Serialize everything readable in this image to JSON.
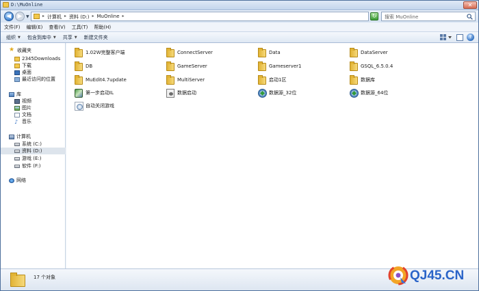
{
  "window": {
    "title": "D:\\MuOnline"
  },
  "address": {
    "crumbs": [
      "计算机",
      "资料 (D:)",
      "MuOnline"
    ],
    "search_placeholder": "搜索 MuOnline"
  },
  "menu": [
    "文件(F)",
    "编辑(E)",
    "查看(V)",
    "工具(T)",
    "帮助(H)"
  ],
  "toolbar": {
    "organize": "组织",
    "include_in_library": "包含到库中",
    "share": "共享",
    "new_folder": "新建文件夹"
  },
  "nav": {
    "favorites": {
      "label": "收藏夹",
      "items": [
        "2345Downloads",
        "下载",
        "桌面",
        "最近访问的位置"
      ]
    },
    "libraries": {
      "label": "库",
      "items": [
        "视频",
        "图片",
        "文档",
        "音乐"
      ]
    },
    "computer": {
      "label": "计算机",
      "items": [
        "系统 (C:)",
        "资料 (D:)",
        "游戏 (E:)",
        "软件 (F:)"
      ],
      "selected": "资料 (D:)"
    },
    "network": {
      "label": "网络"
    }
  },
  "files": [
    {
      "name": "1.02W完整客户端",
      "icon": "folder-icon"
    },
    {
      "name": "ConnectServer",
      "icon": "folder-icon"
    },
    {
      "name": "Data",
      "icon": "folder-icon"
    },
    {
      "name": "DataServer",
      "icon": "folder-icon"
    },
    {
      "name": "DB",
      "icon": "folder-icon"
    },
    {
      "name": "GameServer",
      "icon": "folder-icon"
    },
    {
      "name": "Gameserver1",
      "icon": "folder-icon"
    },
    {
      "name": "GSQL_6.5.0.4",
      "icon": "folder-icon"
    },
    {
      "name": "MuEdit4.7update",
      "icon": "folder-icon"
    },
    {
      "name": "MultiServer",
      "icon": "folder-icon"
    },
    {
      "name": "启动1区",
      "icon": "folder-icon"
    },
    {
      "name": "数据库",
      "icon": "folder-icon"
    },
    {
      "name": "第一步启动IL",
      "icon": "exe-icon"
    },
    {
      "name": "数据启动",
      "icon": "batch-file-icon"
    },
    {
      "name": "数据源_32位",
      "icon": "odbc-icon"
    },
    {
      "name": "数据源_64位",
      "icon": "odbc-icon"
    },
    {
      "name": "自动关闭游戏",
      "icon": "shortcut-icon"
    }
  ],
  "details": {
    "count": "17 个对象"
  },
  "watermark": {
    "text": "QJ45.CN"
  },
  "colors": {
    "accent": "#3a7fd0",
    "selection": "#dde4ec",
    "folder": "#f2c84b"
  }
}
